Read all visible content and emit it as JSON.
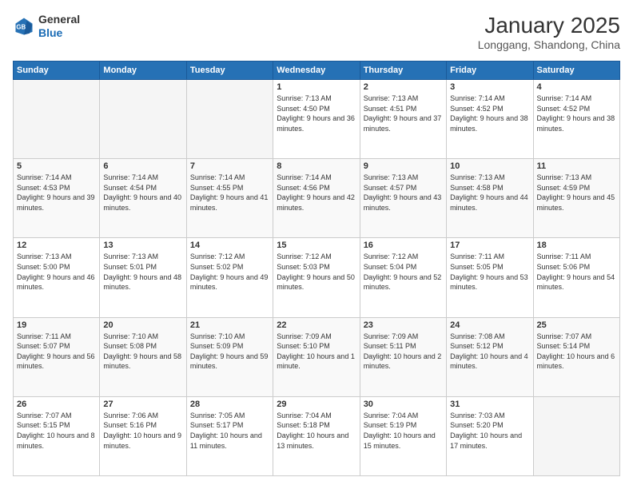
{
  "header": {
    "logo_general": "General",
    "logo_blue": "Blue",
    "month_title": "January 2025",
    "location": "Longgang, Shandong, China"
  },
  "weekdays": [
    "Sunday",
    "Monday",
    "Tuesday",
    "Wednesday",
    "Thursday",
    "Friday",
    "Saturday"
  ],
  "weeks": [
    [
      {
        "day": "",
        "info": ""
      },
      {
        "day": "",
        "info": ""
      },
      {
        "day": "",
        "info": ""
      },
      {
        "day": "1",
        "info": "Sunrise: 7:13 AM\nSunset: 4:50 PM\nDaylight: 9 hours and 36 minutes."
      },
      {
        "day": "2",
        "info": "Sunrise: 7:13 AM\nSunset: 4:51 PM\nDaylight: 9 hours and 37 minutes."
      },
      {
        "day": "3",
        "info": "Sunrise: 7:14 AM\nSunset: 4:52 PM\nDaylight: 9 hours and 38 minutes."
      },
      {
        "day": "4",
        "info": "Sunrise: 7:14 AM\nSunset: 4:52 PM\nDaylight: 9 hours and 38 minutes."
      }
    ],
    [
      {
        "day": "5",
        "info": "Sunrise: 7:14 AM\nSunset: 4:53 PM\nDaylight: 9 hours and 39 minutes."
      },
      {
        "day": "6",
        "info": "Sunrise: 7:14 AM\nSunset: 4:54 PM\nDaylight: 9 hours and 40 minutes."
      },
      {
        "day": "7",
        "info": "Sunrise: 7:14 AM\nSunset: 4:55 PM\nDaylight: 9 hours and 41 minutes."
      },
      {
        "day": "8",
        "info": "Sunrise: 7:14 AM\nSunset: 4:56 PM\nDaylight: 9 hours and 42 minutes."
      },
      {
        "day": "9",
        "info": "Sunrise: 7:13 AM\nSunset: 4:57 PM\nDaylight: 9 hours and 43 minutes."
      },
      {
        "day": "10",
        "info": "Sunrise: 7:13 AM\nSunset: 4:58 PM\nDaylight: 9 hours and 44 minutes."
      },
      {
        "day": "11",
        "info": "Sunrise: 7:13 AM\nSunset: 4:59 PM\nDaylight: 9 hours and 45 minutes."
      }
    ],
    [
      {
        "day": "12",
        "info": "Sunrise: 7:13 AM\nSunset: 5:00 PM\nDaylight: 9 hours and 46 minutes."
      },
      {
        "day": "13",
        "info": "Sunrise: 7:13 AM\nSunset: 5:01 PM\nDaylight: 9 hours and 48 minutes."
      },
      {
        "day": "14",
        "info": "Sunrise: 7:12 AM\nSunset: 5:02 PM\nDaylight: 9 hours and 49 minutes."
      },
      {
        "day": "15",
        "info": "Sunrise: 7:12 AM\nSunset: 5:03 PM\nDaylight: 9 hours and 50 minutes."
      },
      {
        "day": "16",
        "info": "Sunrise: 7:12 AM\nSunset: 5:04 PM\nDaylight: 9 hours and 52 minutes."
      },
      {
        "day": "17",
        "info": "Sunrise: 7:11 AM\nSunset: 5:05 PM\nDaylight: 9 hours and 53 minutes."
      },
      {
        "day": "18",
        "info": "Sunrise: 7:11 AM\nSunset: 5:06 PM\nDaylight: 9 hours and 54 minutes."
      }
    ],
    [
      {
        "day": "19",
        "info": "Sunrise: 7:11 AM\nSunset: 5:07 PM\nDaylight: 9 hours and 56 minutes."
      },
      {
        "day": "20",
        "info": "Sunrise: 7:10 AM\nSunset: 5:08 PM\nDaylight: 9 hours and 58 minutes."
      },
      {
        "day": "21",
        "info": "Sunrise: 7:10 AM\nSunset: 5:09 PM\nDaylight: 9 hours and 59 minutes."
      },
      {
        "day": "22",
        "info": "Sunrise: 7:09 AM\nSunset: 5:10 PM\nDaylight: 10 hours and 1 minute."
      },
      {
        "day": "23",
        "info": "Sunrise: 7:09 AM\nSunset: 5:11 PM\nDaylight: 10 hours and 2 minutes."
      },
      {
        "day": "24",
        "info": "Sunrise: 7:08 AM\nSunset: 5:12 PM\nDaylight: 10 hours and 4 minutes."
      },
      {
        "day": "25",
        "info": "Sunrise: 7:07 AM\nSunset: 5:14 PM\nDaylight: 10 hours and 6 minutes."
      }
    ],
    [
      {
        "day": "26",
        "info": "Sunrise: 7:07 AM\nSunset: 5:15 PM\nDaylight: 10 hours and 8 minutes."
      },
      {
        "day": "27",
        "info": "Sunrise: 7:06 AM\nSunset: 5:16 PM\nDaylight: 10 hours and 9 minutes."
      },
      {
        "day": "28",
        "info": "Sunrise: 7:05 AM\nSunset: 5:17 PM\nDaylight: 10 hours and 11 minutes."
      },
      {
        "day": "29",
        "info": "Sunrise: 7:04 AM\nSunset: 5:18 PM\nDaylight: 10 hours and 13 minutes."
      },
      {
        "day": "30",
        "info": "Sunrise: 7:04 AM\nSunset: 5:19 PM\nDaylight: 10 hours and 15 minutes."
      },
      {
        "day": "31",
        "info": "Sunrise: 7:03 AM\nSunset: 5:20 PM\nDaylight: 10 hours and 17 minutes."
      },
      {
        "day": "",
        "info": ""
      }
    ]
  ]
}
